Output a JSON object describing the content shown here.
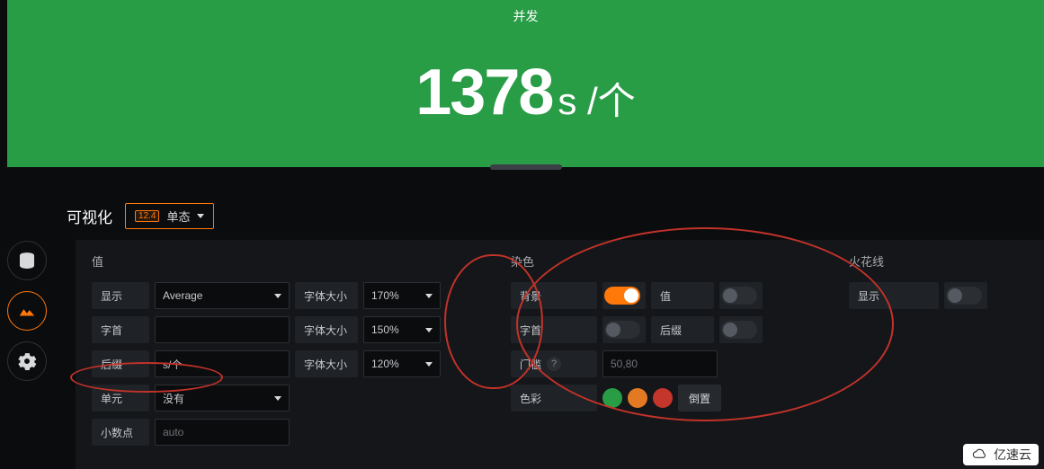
{
  "preview": {
    "title": "并发",
    "value": "1378",
    "suffix": "s /个",
    "bg_color": "#299c46"
  },
  "tab": {
    "title": "可视化",
    "badge": "12.4",
    "type": "单态"
  },
  "value_section": {
    "heading": "值",
    "show_label": "显示",
    "show_value": "Average",
    "prefix_label": "字首",
    "prefix_value": "",
    "suffix_label": "后缀",
    "suffix_value": "s/个",
    "unit_label": "单元",
    "unit_value": "没有",
    "decimals_label": "小数点",
    "decimals_placeholder": "auto",
    "font_label": "字体大小",
    "font_value_main": "170%",
    "font_value_prefix": "150%",
    "font_value_suffix": "120%"
  },
  "coloring_section": {
    "heading": "染色",
    "background_label": "背景",
    "background_on": true,
    "value_label": "值",
    "value_on": false,
    "prefix_label": "字首",
    "prefix_on": false,
    "suffix_label": "后缀",
    "suffix_on": false,
    "thresholds_label": "门槛",
    "thresholds_value": "50,80",
    "colors_label": "色彩",
    "invert_label": "倒置",
    "color1": "#299c46",
    "color2": "#e37a23",
    "color3": "#c4352b"
  },
  "spark_section": {
    "heading": "火花线",
    "show_label": "显示",
    "show_on": false
  },
  "watermark": "亿速云"
}
